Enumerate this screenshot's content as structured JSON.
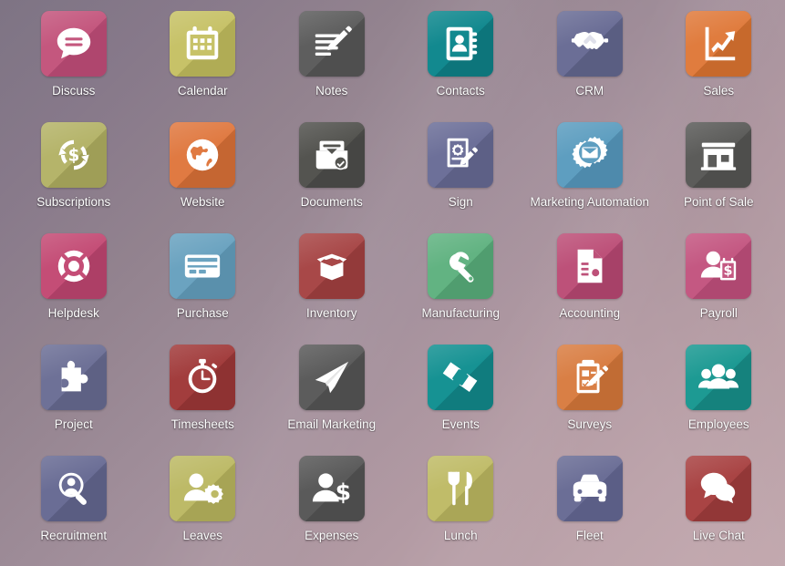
{
  "desktop": {
    "title": "Apps",
    "background": {
      "from": "#7e7484",
      "mid": "#a3909c",
      "to": "#c5abb1"
    },
    "grid": {
      "columns": 6,
      "rows": 5
    }
  },
  "apps": [
    {
      "label": "Discuss",
      "icon": "chat-bubble-icon",
      "color": "#c4577e",
      "shadow": "#a84169"
    },
    {
      "label": "Calendar",
      "icon": "calendar-icon",
      "color": "#c7c268",
      "shadow": "#a9a44f"
    },
    {
      "label": "Notes",
      "icon": "note-pencil-icon",
      "color": "#5e5e5e",
      "shadow": "#4a4a4a"
    },
    {
      "label": "Contacts",
      "icon": "address-book-icon",
      "color": "#12898f",
      "shadow": "#0b6e74"
    },
    {
      "label": "CRM",
      "icon": "handshake-icon",
      "color": "#6b6e96",
      "shadow": "#55587c"
    },
    {
      "label": "Sales",
      "icon": "chart-growth-icon",
      "color": "#e07c3e",
      "shadow": "#bf6326"
    },
    {
      "label": "Subscriptions",
      "icon": "recurring-dollar-icon",
      "color": "#b5b46a",
      "shadow": "#989751"
    },
    {
      "label": "Website",
      "icon": "globe-icon",
      "color": "#e07a42",
      "shadow": "#bc5f2c"
    },
    {
      "label": "Documents",
      "icon": "document-tray-icon",
      "color": "#545450",
      "shadow": "#424240"
    },
    {
      "label": "Sign",
      "icon": "signature-doc-icon",
      "color": "#6d7099",
      "shadow": "#585b80"
    },
    {
      "label": "Marketing Automation",
      "icon": "gear-mail-icon",
      "color": "#5e9ec0",
      "shadow": "#4983a5"
    },
    {
      "label": "Point of Sale",
      "icon": "storefront-icon",
      "color": "#5c5c5a",
      "shadow": "#494947"
    },
    {
      "label": "Helpdesk",
      "icon": "lifebuoy-icon",
      "color": "#c44d76",
      "shadow": "#a53a61"
    },
    {
      "label": "Purchase",
      "icon": "credit-card-icon",
      "color": "#6ba3c0",
      "shadow": "#5489a5"
    },
    {
      "label": "Inventory",
      "icon": "open-box-icon",
      "color": "#a84848",
      "shadow": "#8c3636"
    },
    {
      "label": "Manufacturing",
      "icon": "wrench-icon",
      "color": "#62b382",
      "shadow": "#4a9669"
    },
    {
      "label": "Accounting",
      "icon": "invoice-gear-icon",
      "color": "#bd5179",
      "shadow": "#a03c63"
    },
    {
      "label": "Payroll",
      "icon": "person-money-icon",
      "color": "#c45882",
      "shadow": "#a8436b"
    },
    {
      "label": "Project",
      "icon": "puzzle-piece-icon",
      "color": "#6e7197",
      "shadow": "#595c7e"
    },
    {
      "label": "Timesheets",
      "icon": "stopwatch-icon",
      "color": "#a23d3d",
      "shadow": "#872e2e"
    },
    {
      "label": "Email Marketing",
      "icon": "paper-plane-icon",
      "color": "#5c5c5c",
      "shadow": "#484848"
    },
    {
      "label": "Events",
      "icon": "ticket-icon",
      "color": "#169293",
      "shadow": "#0e7577"
    },
    {
      "label": "Surveys",
      "icon": "clipboard-pencil-icon",
      "color": "#d97f45",
      "shadow": "#b9662f"
    },
    {
      "label": "Employees",
      "icon": "people-group-icon",
      "color": "#1d9a93",
      "shadow": "#127a76"
    },
    {
      "label": "Recruitment",
      "icon": "person-search-icon",
      "color": "#6a6d95",
      "shadow": "#55587c"
    },
    {
      "label": "Leaves",
      "icon": "person-gear-icon",
      "color": "#bdba67",
      "shadow": "#a09d4f"
    },
    {
      "label": "Expenses",
      "icon": "person-dollar-icon",
      "color": "#5a5a5a",
      "shadow": "#474747"
    },
    {
      "label": "Lunch",
      "icon": "fork-knife-icon",
      "color": "#c0bc69",
      "shadow": "#a29e51"
    },
    {
      "label": "Fleet",
      "icon": "car-icon",
      "color": "#6b6e96",
      "shadow": "#565980"
    },
    {
      "label": "Live Chat",
      "icon": "chat-bubbles-icon",
      "color": "#a94444",
      "shadow": "#8b3333"
    }
  ]
}
